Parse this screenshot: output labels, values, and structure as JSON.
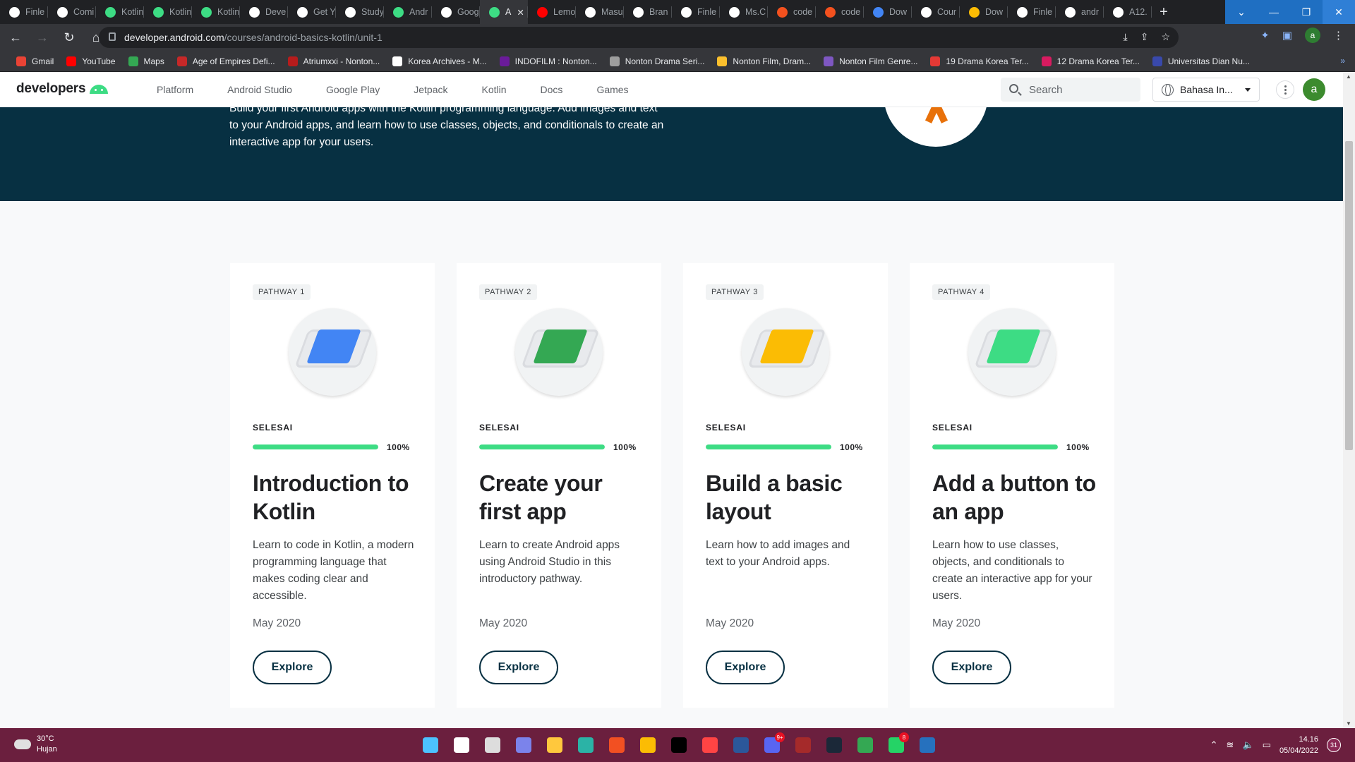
{
  "browser": {
    "tabs": [
      {
        "label": "Finle",
        "icon": "github-icon",
        "color": "#ffffff"
      },
      {
        "label": "Comi",
        "icon": "jetbrains-icon",
        "color": "#ffffff"
      },
      {
        "label": "Kotlin",
        "icon": "w-icon",
        "color": "#3ddc84"
      },
      {
        "label": "Kotlin",
        "icon": "w-icon",
        "color": "#3ddc84"
      },
      {
        "label": "Kotlin",
        "icon": "w-icon",
        "color": "#3ddc84"
      },
      {
        "label": "Deve",
        "icon": "jetbrains-icon",
        "color": "#ffffff"
      },
      {
        "label": "Get Y",
        "icon": "jetbrains-icon",
        "color": "#ffffff"
      },
      {
        "label": "Study",
        "icon": "z-icon",
        "color": "#ffffff"
      },
      {
        "label": "Andr",
        "icon": "android-icon",
        "color": "#3ddc84"
      },
      {
        "label": "Goog",
        "icon": "google-icon",
        "color": "#ffffff"
      },
      {
        "label": "A",
        "icon": "android-icon",
        "color": "#3ddc84",
        "active": true
      },
      {
        "label": "Lemo",
        "icon": "youtube-icon",
        "color": "#ff0000"
      },
      {
        "label": "Masu",
        "icon": "google-icon",
        "color": "#ffffff"
      },
      {
        "label": "Bran",
        "icon": "github-icon",
        "color": "#ffffff"
      },
      {
        "label": "Finle",
        "icon": "github-icon",
        "color": "#ffffff"
      },
      {
        "label": "Ms.C",
        "icon": "circle-icon",
        "color": "#ffffff"
      },
      {
        "label": "code",
        "icon": "code-icon",
        "color": "#f4511e"
      },
      {
        "label": "code",
        "icon": "code-icon",
        "color": "#f4511e"
      },
      {
        "label": "Dow",
        "icon": "download-icon",
        "color": "#4285f4"
      },
      {
        "label": "Cour",
        "icon": "m-icon",
        "color": "#ffffff"
      },
      {
        "label": "Dow",
        "icon": "windows-icon",
        "color": "#fbbc04"
      },
      {
        "label": "Finle",
        "icon": "github-icon",
        "color": "#ffffff"
      },
      {
        "label": "andr",
        "icon": "github-icon",
        "color": "#ffffff"
      },
      {
        "label": "A12.",
        "icon": "m-icon",
        "color": "#ffffff"
      }
    ],
    "new_tab": "+",
    "url_domain": "developer.android.com",
    "url_path": "/courses/android-basics-kotlin/unit-1",
    "profile_initial": "a",
    "bookmarks": [
      {
        "label": "Gmail",
        "color": "#ea4335"
      },
      {
        "label": "YouTube",
        "color": "#ff0000"
      },
      {
        "label": "Maps",
        "color": "#34a853"
      },
      {
        "label": "Age of Empires Defi...",
        "color": "#c62828"
      },
      {
        "label": "Atriumxxi - Nonton...",
        "color": "#b71c1c"
      },
      {
        "label": "Korea Archives - M...",
        "color": "#ffffff"
      },
      {
        "label": "INDOFILM : Nonton...",
        "color": "#6a1b9a"
      },
      {
        "label": "Nonton Drama Seri...",
        "color": "#9e9e9e"
      },
      {
        "label": "Nonton Film, Dram...",
        "color": "#fbc02d"
      },
      {
        "label": "Nonton Film Genre...",
        "color": "#7e57c2"
      },
      {
        "label": "19 Drama Korea Ter...",
        "color": "#e53935"
      },
      {
        "label": "12 Drama Korea Ter...",
        "color": "#d81b60"
      },
      {
        "label": "Universitas Dian Nu...",
        "color": "#3949ab"
      }
    ],
    "bookmarks_more": "»"
  },
  "site": {
    "logo_text": "developers",
    "nav": [
      "Platform",
      "Android Studio",
      "Google Play",
      "Jetpack",
      "Kotlin",
      "Docs",
      "Games"
    ],
    "search_placeholder": "Search",
    "language": "Bahasa In...",
    "avatar_initial": "a"
  },
  "hero": {
    "description": "Build your first Android apps with the Kotlin programming language. Add images and text to your Android apps, and learn how to use classes, objects, and conditionals to create an interactive app for your users."
  },
  "cards": [
    {
      "pathway": "PATHWAY 1",
      "status": "SELESAI",
      "progress": 100,
      "progress_label": "100%",
      "title": "Introduction to Kotlin",
      "description": "Learn to code in Kotlin, a modern programming language that makes coding clear and accessible.",
      "date": "May 2020",
      "button": "Explore",
      "illustration": "kotlin-phone-icon"
    },
    {
      "pathway": "PATHWAY 2",
      "status": "SELESAI",
      "progress": 100,
      "progress_label": "100%",
      "title": "Create your first app",
      "description": "Learn to create Android apps using Android Studio in this introductory pathway.",
      "date": "May 2020",
      "button": "Explore",
      "illustration": "first-app-icon"
    },
    {
      "pathway": "PATHWAY 3",
      "status": "SELESAI",
      "progress": 100,
      "progress_label": "100%",
      "title": "Build a basic layout",
      "description": "Learn how to add images and text to your Android apps.",
      "date": "May 2020",
      "button": "Explore",
      "illustration": "layout-folder-icon"
    },
    {
      "pathway": "PATHWAY 4",
      "status": "SELESAI",
      "progress": 100,
      "progress_label": "100%",
      "title": "Add a button to an app",
      "description": "Learn how to use classes, objects, and conditionals to create an interactive app for your users.",
      "date": "May 2020",
      "button": "Explore",
      "illustration": "dice-icon"
    }
  ],
  "taskbar": {
    "weather_temp": "30°C",
    "weather_desc": "Hujan",
    "apps": [
      {
        "name": "start-icon",
        "color": "#4cc2ff"
      },
      {
        "name": "search-icon",
        "color": "#ffffff"
      },
      {
        "name": "task-view-icon",
        "color": "#dddddd"
      },
      {
        "name": "teams-icon",
        "color": "#7b83eb"
      },
      {
        "name": "file-explorer-icon",
        "color": "#ffc83d"
      },
      {
        "name": "edge-icon",
        "color": "#2bb3a6"
      },
      {
        "name": "store-icon",
        "color": "#f25022"
      },
      {
        "name": "chrome-icon",
        "color": "#fbbc04"
      },
      {
        "name": "jetbrains-icon",
        "color": "#000000"
      },
      {
        "name": "davinci-icon",
        "color": "#ff4444"
      },
      {
        "name": "word-icon",
        "color": "#2b579a"
      },
      {
        "name": "discord-icon",
        "color": "#5865f2",
        "badge": "9+"
      },
      {
        "name": "winrar-icon",
        "color": "#a52a2a"
      },
      {
        "name": "steam-icon",
        "color": "#1b2838"
      },
      {
        "name": "chrome-active-icon",
        "color": "#34a853"
      },
      {
        "name": "whatsapp-icon",
        "color": "#25d366",
        "badge": "8"
      },
      {
        "name": "powershell-icon",
        "color": "#2671be"
      }
    ],
    "time": "14.16",
    "date": "05/04/2022",
    "notification_count": "31"
  }
}
